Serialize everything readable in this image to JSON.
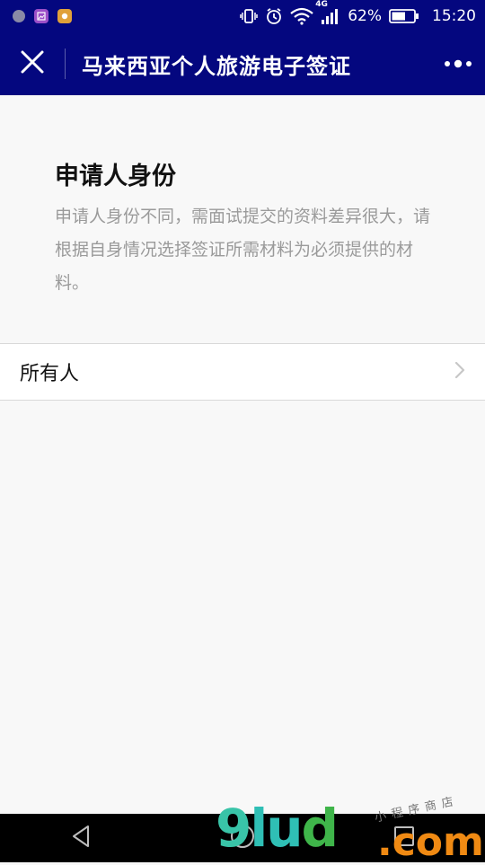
{
  "status_bar": {
    "network": "4G",
    "battery": "62%",
    "time": "15:20"
  },
  "nav": {
    "title": "马来西亚个人旅游电子签证"
  },
  "section": {
    "title": "申请人身份",
    "description": "申请人身份不同，需面试提交的资料差异很大，请根据自身情况选择签证所需材料为必须提供的材料。"
  },
  "list": {
    "items": [
      {
        "label": "所有人"
      }
    ]
  },
  "watermark": {
    "main_g": "9",
    "main_l": "lu",
    "main_d": "d",
    "suffix": ".com",
    "sub": "小程序商店"
  },
  "colors": {
    "header_bg": "#04077f",
    "page_bg": "#f8f8f8"
  }
}
